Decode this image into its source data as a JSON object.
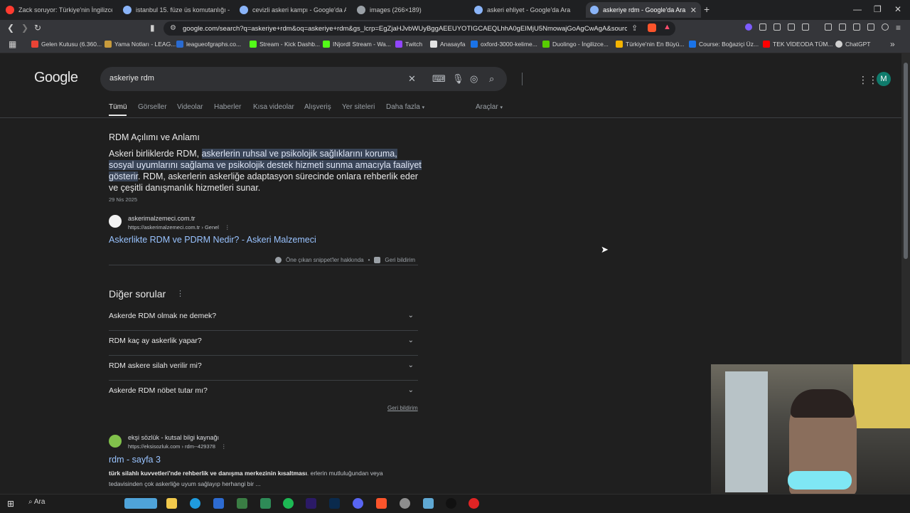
{
  "tabs": [
    {
      "title": "Zack soruyor: Türkiye'nin İngilizce Eğ",
      "color": "#ff3b30"
    },
    {
      "title": "istanbul 15. füze üs komutanlığı - Go",
      "color": "#8ab4f8"
    },
    {
      "title": "cevizli askeri kampı - Google'da Ara",
      "color": "#8ab4f8"
    },
    {
      "title": "images (266×189)",
      "color": "#9aa0a6"
    },
    {
      "title": "askeri ehliyet - Google'da Ara",
      "color": "#8ab4f8"
    },
    {
      "title": "askeriye rdm - Google'da Ara",
      "color": "#8ab4f8",
      "active": true
    }
  ],
  "address_bar": {
    "url": "google.com/search?q=askeriye+rdm&oq=askeriye+rdm&gs_lcrp=EgZjaHJvbWUyBggAEEUYOTIGCAEQLhhA0gEIMjU5NmowajGoAgCwAgA&sourceid..."
  },
  "bookmarks": [
    {
      "label": "Gelen Kutusu (6.360...",
      "color": "#ea4335"
    },
    {
      "label": "Yama Notları - LEAG...",
      "color": "#c89b3c"
    },
    {
      "label": "leagueofgraphs.co...",
      "color": "#2a6bd1"
    },
    {
      "label": "Stream - Kick Dashb...",
      "color": "#53fc18"
    },
    {
      "label": "INjordI Stream - Wa...",
      "color": "#53fc18"
    },
    {
      "label": "Twitch",
      "color": "#9146ff"
    },
    {
      "label": "Anasayfa",
      "color": "#e3e3e3"
    },
    {
      "label": "oxford-3000-kelime...",
      "color": "#1a73e8"
    },
    {
      "label": "Duolingo - İngilizce...",
      "color": "#58cc02"
    },
    {
      "label": "Türkiye'nin En Büyü...",
      "color": "#f4b400"
    },
    {
      "label": "Course: Boğaziçi Üz...",
      "color": "#1a73e8"
    },
    {
      "label": "TEK VİDEODA TÜM...",
      "color": "#ff0000"
    },
    {
      "label": "ChatGPT",
      "color": "#d0d0d0"
    }
  ],
  "google": {
    "logo": "Google",
    "search_value": "askeriye rdm",
    "avatar_letter": "M",
    "filter_tabs": [
      "Tümü",
      "Görseller",
      "Videolar",
      "Haberler",
      "Kısa videolar",
      "Alışveriş",
      "Yer siteleri",
      "Daha fazla"
    ],
    "tools_label": "Araçlar"
  },
  "snippet": {
    "title": "RDM Açılımı ve Anlamı",
    "body_pre": "Askeri birliklerde RDM, ",
    "body_highlight": "askerlerin ruhsal ve psikolojik sağlıklarını koruma, sosyal uyumlarını sağlama ve psikolojik destek hizmeti sunma amacıyla faaliyet gösterir",
    "body_post": ". RDM, askerlerin askerliğe adaptasyon sürecinde onlara rehberlik eder ve çeşitli danışmanlık hizmetleri sunar.",
    "date": "29 Nis 2025",
    "site_name": "askerimalzemeci.com.tr",
    "site_url": "https://askerimalzemeci.com.tr › Genel",
    "link": "Askerlikte RDM ve PDRM Nedir? - Askeri Malzemeci",
    "about": "Öne çıkan snippet'ler hakkında",
    "feedback": "Geri bildirim"
  },
  "paa": {
    "title": "Diğer sorular",
    "questions": [
      "Askerde RDM olmak ne demek?",
      "RDM kaç ay askerlik yapar?",
      "RDM askere silah verilir mi?",
      "Askerde RDM nöbet tutar mı?"
    ],
    "feedback": "Geri bildirim"
  },
  "result2": {
    "site_name": "ekşi sözlük - kutsal bilgi kaynağı",
    "site_url": "https://eksisozluk.com › rdm--429378",
    "link": "rdm - sayfa 3",
    "snippet_bold": "türk silahlı kuvvetleri'nde rehberlik ve danışma merkezinin kısaltması",
    "snippet_rest": ". erlerin mutluluğundan veya tedavisinden çok askerliğe uyum sağlayıp herhangi bir ..."
  },
  "taskbar": {
    "search_label": "Ara"
  }
}
